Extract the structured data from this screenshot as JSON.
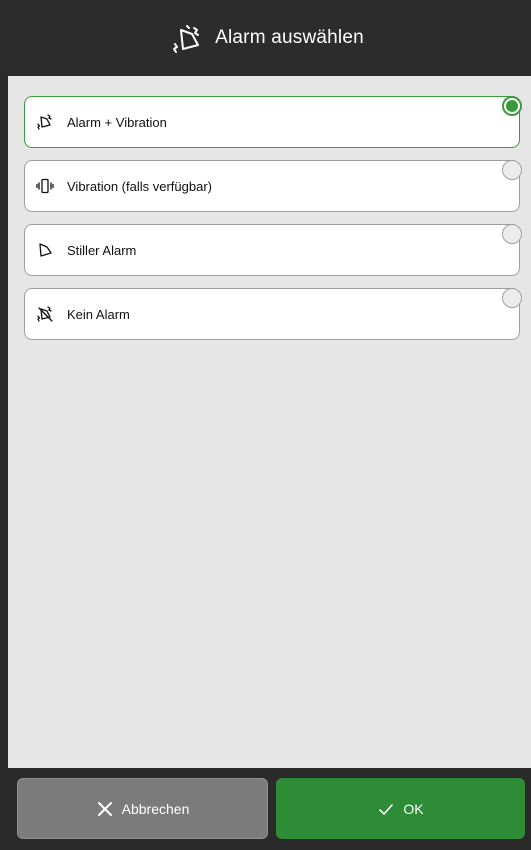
{
  "dialog": {
    "title": "Alarm auswählen",
    "title_icon": "alarm-vibration-icon"
  },
  "options": [
    {
      "label": "Alarm + Vibration",
      "icon": "alarm-vibration-icon",
      "selected": true
    },
    {
      "label": "Vibration (falls verfügbar)",
      "icon": "vibration-icon",
      "selected": false
    },
    {
      "label": "Stiller Alarm",
      "icon": "silent-alarm-icon",
      "selected": false
    },
    {
      "label": "Kein Alarm",
      "icon": "no-alarm-icon",
      "selected": false
    }
  ],
  "footer": {
    "cancel_label": "Abbrechen",
    "cancel_icon": "close-icon",
    "ok_label": "OK",
    "ok_icon": "checkmark-icon"
  },
  "colors": {
    "accent_green": "#2e8b36",
    "header_bg": "#2c2c2c",
    "content_bg": "#e6e6e6",
    "cancel_bg": "#7b7b7b"
  }
}
